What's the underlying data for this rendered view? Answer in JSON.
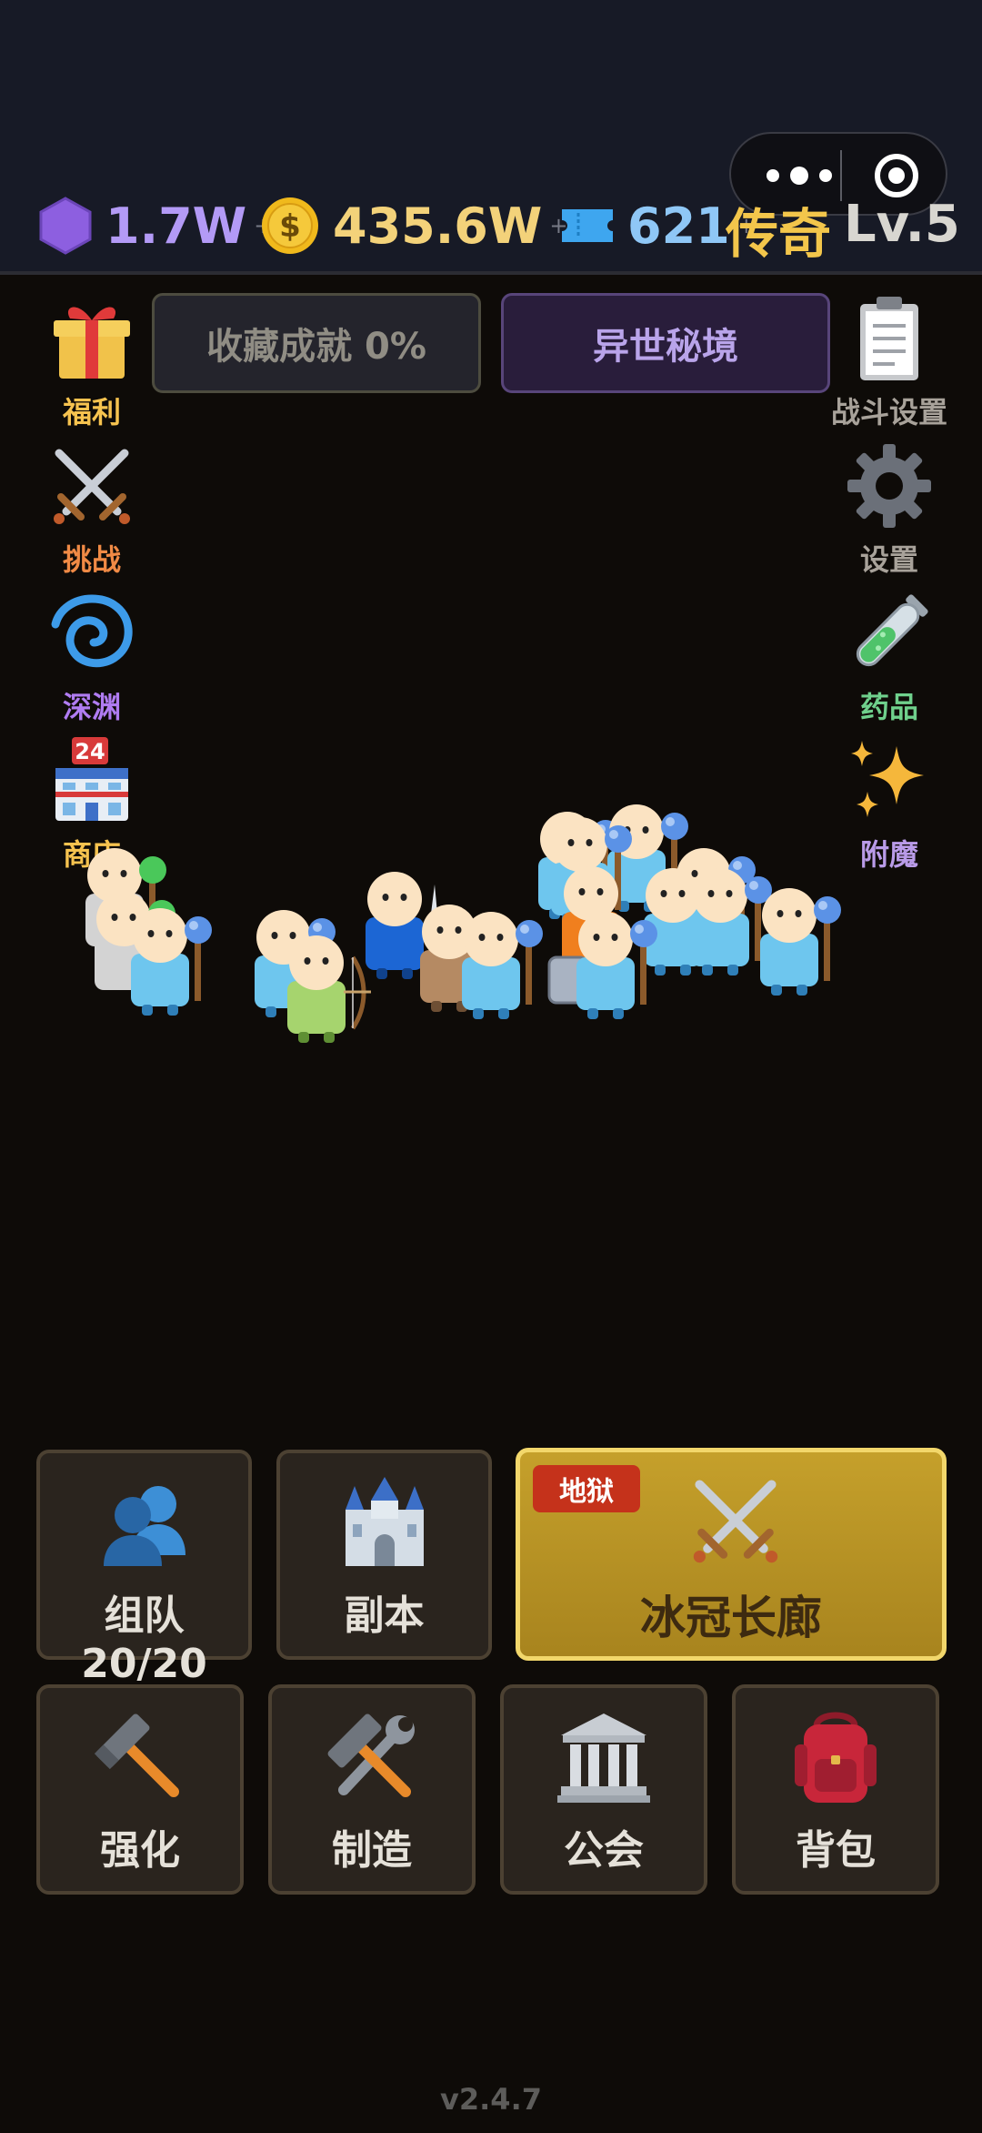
{
  "resources": {
    "gems": "1.7W",
    "gold": "435.6W",
    "tickets": "621",
    "plus": "+"
  },
  "player": {
    "rank": "传奇",
    "level": "Lv.5"
  },
  "left_menu": [
    {
      "label": "福利",
      "icon": "gift-icon",
      "color": "#f6c34f"
    },
    {
      "label": "挑战",
      "icon": "crossed-swords-icon",
      "color": "#f08a45"
    },
    {
      "label": "深渊",
      "icon": "cyclone-icon",
      "color": "#b07cf2"
    },
    {
      "label": "商店",
      "icon": "store-icon",
      "color": "#f6c34f"
    }
  ],
  "right_menu": [
    {
      "label": "战斗设置",
      "icon": "clipboard-icon",
      "color": "#a8a29a"
    },
    {
      "label": "设置",
      "icon": "gear-icon",
      "color": "#a8a29a"
    },
    {
      "label": "药品",
      "icon": "test-tube-icon",
      "color": "#6fd08c"
    },
    {
      "label": "附魔",
      "icon": "sparkles-icon",
      "color": "#b99be8"
    }
  ],
  "banners": {
    "collection": "收藏成就 0%",
    "secret_realm": "异世秘境"
  },
  "store_badge": "24",
  "actions": {
    "team": "组队 20/20",
    "dungeon": "副本",
    "featured": {
      "badge": "地狱",
      "label": "冰冠长廊"
    },
    "enhance": "强化",
    "craft": "制造",
    "guild": "公会",
    "backpack": "背包"
  },
  "version": "v2.4.7",
  "colors": {
    "gold_accent": "#f2d76b",
    "hell_badge": "#c5321b",
    "gem": "#8d5fe0",
    "ticket": "#3ea6ef"
  }
}
